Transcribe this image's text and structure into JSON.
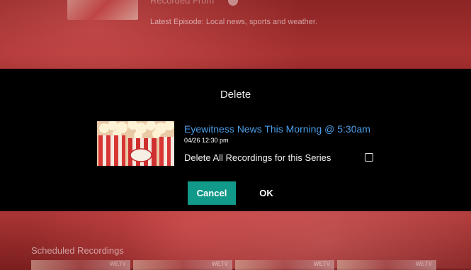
{
  "background": {
    "top_title": "Recorded From",
    "latest_episode": "Latest Episode: Local news, sports and weather.",
    "section_title": "Scheduled Recordings",
    "tile_logos": [
      "WETV",
      "WETV",
      "WETV",
      "WETV"
    ]
  },
  "dialog": {
    "title": "Delete",
    "recording": {
      "title": "Eyewitness News This Morning @ 5:30am",
      "datetime": "04/26 12:30 pm",
      "thumbnail_text": "POP CORN"
    },
    "series_option": {
      "label": "Delete All Recordings for this Series",
      "checked": false
    },
    "buttons": {
      "cancel": "Cancel",
      "ok": "OK"
    }
  },
  "colors": {
    "accent": "#11998a",
    "title_link": "#4a9de8",
    "dialog_bg": "#000000"
  }
}
